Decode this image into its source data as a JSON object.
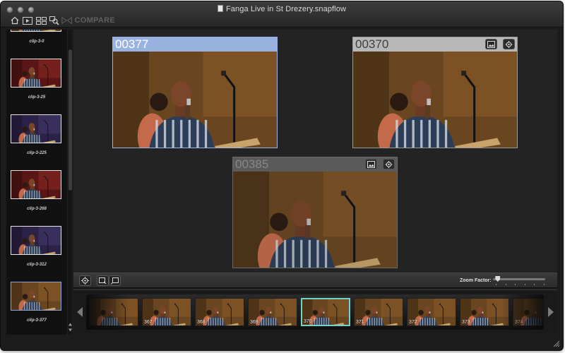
{
  "window": {
    "title": "Fanga Live in St Drezery.snapflow"
  },
  "toolbar": {
    "items": [
      {
        "icon": "home-icon"
      },
      {
        "icon": "play-icon"
      },
      {
        "icon": "layout-grid-icon"
      },
      {
        "icon": "search-icon"
      },
      {
        "icon": "compare-icon",
        "label": "COMPARE"
      }
    ]
  },
  "sidebar": {
    "clips": [
      {
        "label": "clip-3-0",
        "selected": false
      },
      {
        "label": "clip-3-25",
        "selected": false
      },
      {
        "label": "clip-3-225",
        "selected": false
      },
      {
        "label": "clip-3-268",
        "selected": false
      },
      {
        "label": "clip-3-312",
        "selected": false
      },
      {
        "label": "clip-3-377",
        "selected": true
      }
    ]
  },
  "panels": [
    {
      "code": "00377",
      "state": "selected",
      "buttons": []
    },
    {
      "code": "00370",
      "state": "normal",
      "buttons": [
        "image-export-icon",
        "target-icon"
      ]
    },
    {
      "code": "00385",
      "state": "dimmed",
      "buttons": [
        "image-export-icon",
        "target-icon"
      ]
    }
  ],
  "control_bar": {
    "zoom_label": "Zoom Factor:",
    "zoom_value": 0.05
  },
  "filmstrip": {
    "frames": [
      {
        "label": "",
        "selected": false
      },
      {
        "label": "367",
        "selected": false
      },
      {
        "label": "368",
        "selected": false
      },
      {
        "label": "369",
        "selected": false
      },
      {
        "label": "370",
        "selected": true
      },
      {
        "label": "371",
        "selected": false
      },
      {
        "label": "372",
        "selected": false
      },
      {
        "label": "373",
        "selected": false
      },
      {
        "label": "374",
        "selected": false
      }
    ]
  },
  "colors": {
    "selected_panel_header": "#9ab2e0",
    "normal_panel_header": "#b8b8b8",
    "dimmed_panel_header": "#5a5a5a",
    "filmstrip_selection": "#6fd3c7",
    "background": "#1c1c1c"
  }
}
